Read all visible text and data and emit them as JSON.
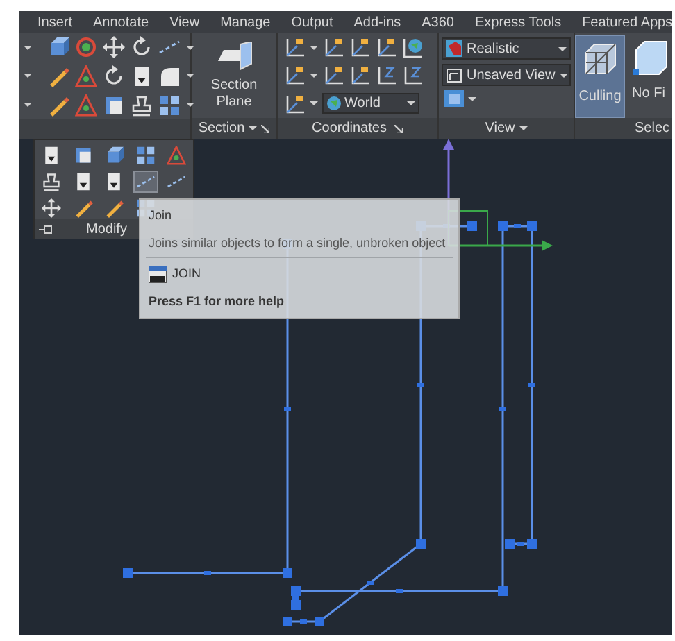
{
  "ribbon_tabs": [
    {
      "label": "Insert"
    },
    {
      "label": "Annotate"
    },
    {
      "label": "View"
    },
    {
      "label": "Manage"
    },
    {
      "label": "Output"
    },
    {
      "label": "Add-ins"
    },
    {
      "label": "A360"
    },
    {
      "label": "Express Tools"
    },
    {
      "label": "Featured Apps"
    }
  ],
  "section_panel": {
    "button": "Section Plane",
    "title": "Section"
  },
  "coordinates_panel": {
    "ucs_dropdown": "World",
    "title": "Coordinates"
  },
  "view_panel": {
    "visual_style": "Realistic",
    "named_view": "Unsaved View",
    "title": "View"
  },
  "culling_button": {
    "label": "Culling",
    "on": true
  },
  "no_filter_button": {
    "label": "No Fi"
  },
  "selection_panel": {
    "title": "Selec"
  },
  "modify_panel": {
    "title": "Modify",
    "tools": [
      {
        "selected": false
      },
      {
        "selected": false
      },
      {
        "selected": false
      },
      {
        "selected": false
      },
      {
        "selected": false
      },
      {
        "selected": false
      },
      {
        "selected": false
      },
      {
        "selected": false
      },
      {
        "selected": true
      },
      {
        "selected": false
      },
      {
        "selected": false
      },
      {
        "selected": false
      },
      {
        "selected": false
      },
      {
        "selected": false
      }
    ]
  },
  "tooltip": {
    "title": "Join",
    "description": "Joins similar objects to form a single, unbroken object",
    "command": "JOIN",
    "help": "Press F1 for more help"
  }
}
